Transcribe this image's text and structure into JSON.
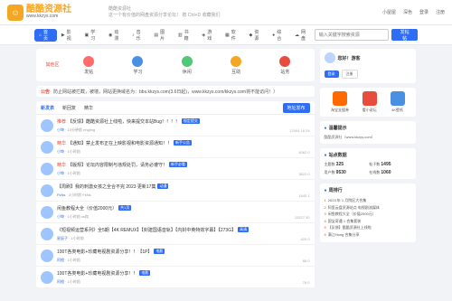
{
  "site": {
    "logo_name": "酷酷资源社",
    "logo_url": "www.kkzys.com",
    "tagline1": "酷酷资源社",
    "tagline2": "这一个有价值的网盘资源分享论坛！ 按 Ctrl+D 收藏我们"
  },
  "top_right": [
    "小屋屋",
    "深色",
    "登录",
    "注册"
  ],
  "nav": [
    {
      "label": "首页",
      "icon": "home-icon"
    },
    {
      "label": "影视",
      "icon": "film-icon"
    },
    {
      "label": "学习",
      "icon": "book-icon"
    },
    {
      "label": "动漫",
      "icon": "anime-icon"
    },
    {
      "label": "音乐",
      "icon": "music-icon"
    },
    {
      "label": "图片",
      "icon": "image-icon"
    },
    {
      "label": "书籍",
      "icon": "books-icon"
    },
    {
      "label": "游戏",
      "icon": "game-icon"
    },
    {
      "label": "软件",
      "icon": "software-icon"
    },
    {
      "label": "资源",
      "icon": "resource-icon"
    },
    {
      "label": "综合",
      "icon": "misc-icon"
    },
    {
      "label": "网盘",
      "icon": "cloud-icon"
    }
  ],
  "search": {
    "placeholder": "输入关键字搜索资源",
    "button": "发帖帖"
  },
  "categories": {
    "label": "其他区",
    "items": [
      {
        "name": "发帖",
        "color": "#ff6b6b"
      },
      {
        "name": "学习",
        "color": "#4a90e2"
      },
      {
        "name": "休闲",
        "color": "#50c878"
      },
      {
        "name": "互助",
        "color": "#f5a623"
      },
      {
        "name": "站务",
        "color": "#e74c3c"
      }
    ]
  },
  "notice": {
    "tag": "公告",
    "text": "防止网站被拦截，被墙，网站更换域名为：bbs.kkzys.com(3.6日起)，www.kkzys.com/kkzys.com将不能访问！）"
  },
  "tabs": {
    "items": [
      "新发表",
      "新回复",
      "精华"
    ],
    "button": "地址发布"
  },
  "posts": [
    {
      "prefix": "推荐",
      "title": "【反馈】酷酷资源社上线啦，快来提交本站Bug！！！！",
      "badge": "规定提交",
      "author": "小坤",
      "time": "10分钟前",
      "reply": "ringling",
      "stats": "12094  16  24"
    },
    {
      "prefix": "精华",
      "title": "【通知】禁止发布正在上映影视和电影资源通知！！",
      "badge": "新手公告",
      "author": "小坤",
      "time": "1小时前",
      "reply": "",
      "stats": "4062  0"
    },
    {
      "prefix": "精华",
      "title": "【版规】论坛内容限制与违规处罚，请务必遵守！",
      "badge": "新手必看",
      "author": "小坤",
      "time": "1小时前",
      "reply": "",
      "stats": "3622  0"
    },
    {
      "prefix": "",
      "title": "【周刷】我的刺激女孩之全合不完 2023 更新17集",
      "badge": "动漫",
      "author": "FkNs",
      "time": "2小时前",
      "reply": "FkNs",
      "stats": "1845  1"
    },
    {
      "prefix": "",
      "title": "闲鱼教程大全（价值2000元）",
      "badge": "共1页",
      "author": "小坤",
      "time": "1小时前",
      "reply": "cs和",
      "stats": "15327  30"
    },
    {
      "prefix": "",
      "title": "《短视频运营系列》全5期【4K REMUX】【封建国语音轨】【内封中英特效字幕】【273G】",
      "badge": "高清",
      "author": "星辰子",
      "time": "1小时前",
      "reply": "",
      "stats": "420  0"
    },
    {
      "prefix": "",
      "title": "100T各类电影+珍藏电视剧资源分享！！【1P】",
      "badge": "电影",
      "author": "阿橙",
      "time": "1小时前",
      "reply": "",
      "stats": "88  0"
    },
    {
      "prefix": "",
      "title": "100T各类电影+珍藏电视剧资源分享！！",
      "badge": "电影",
      "author": "阿橙",
      "time": "1小时前",
      "reply": "",
      "stats": "76  0"
    }
  ],
  "sidebar": {
    "user": {
      "greeting": "您好！游客",
      "btn1": "登录",
      "btn2": "注册"
    },
    "apps": [
      {
        "name": "淘宝支援券",
        "color": "#ff6a00"
      },
      {
        "name": "看小说坛",
        "color": "#e74c3c"
      },
      {
        "name": "4K壁纸",
        "color": "#4a90e2"
      }
    ],
    "tip": {
      "title": "温馨提示",
      "text": "酷酷资源社（www.kkzys.com）"
    },
    "stats_title": "站点数据",
    "stats": [
      {
        "label": "主题数",
        "value": "325"
      },
      {
        "label": "帖子数",
        "value": "1495"
      },
      {
        "label": "用户数",
        "value": "9530"
      },
      {
        "label": "在线数",
        "value": "1060"
      }
    ],
    "rank_title": "周排行",
    "rank": [
      "2023 年 1 月院区大合集",
      "阿里云盘资源站点 电视剧流媒体",
      "闲鱼教程大全（价值2000元）",
      "国宝奇遇 1 合集套装",
      "【反馈】酷酷资源社上线啦",
      "满江Hong 合集分享"
    ]
  }
}
